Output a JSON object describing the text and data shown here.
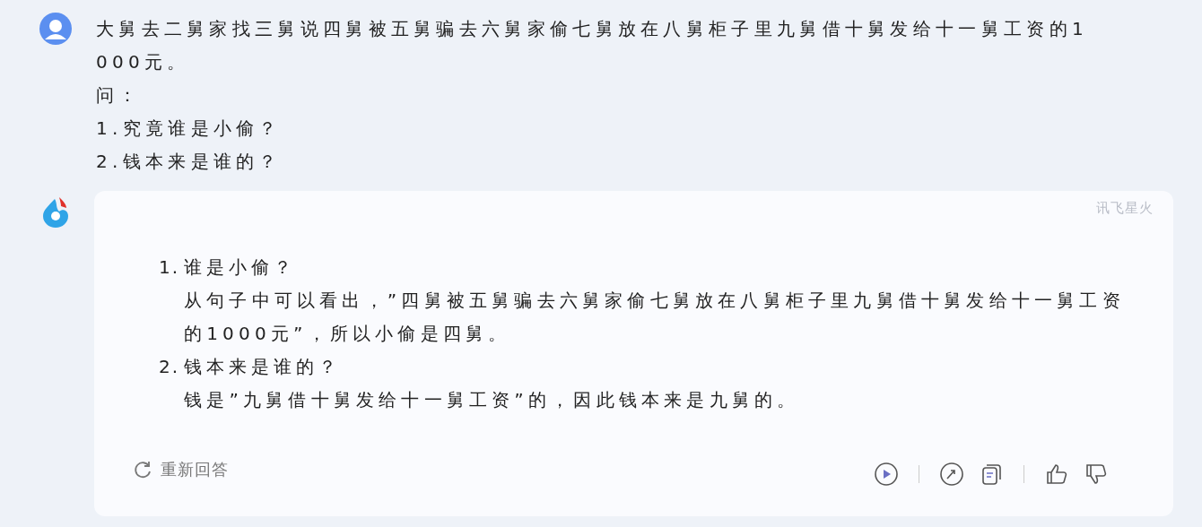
{
  "user_message": {
    "lines": [
      "大舅去二舅家找三舅说四舅被五舅骗去六舅家偷七舅放在八舅柜子里九舅借十舅发给十一舅工资的1000元。",
      "问：",
      "1.究竟谁是小偷？",
      "2.钱本来是谁的？"
    ]
  },
  "answer": {
    "brand": "讯飞星火",
    "items": [
      {
        "number": "1.",
        "title": "谁是小偷？",
        "body": "从句子中可以看出，”四舅被五舅骗去六舅家偷七舅放在八舅柜子里九舅借十舅发给十一舅工资的1000元”，所以小偷是四舅。"
      },
      {
        "number": "2.",
        "title": "钱本来是谁的？",
        "body": "钱是”九舅借十舅发给十一舅工资”的，因此钱本来是九舅的。"
      }
    ],
    "regenerate_label": "重新回答"
  }
}
